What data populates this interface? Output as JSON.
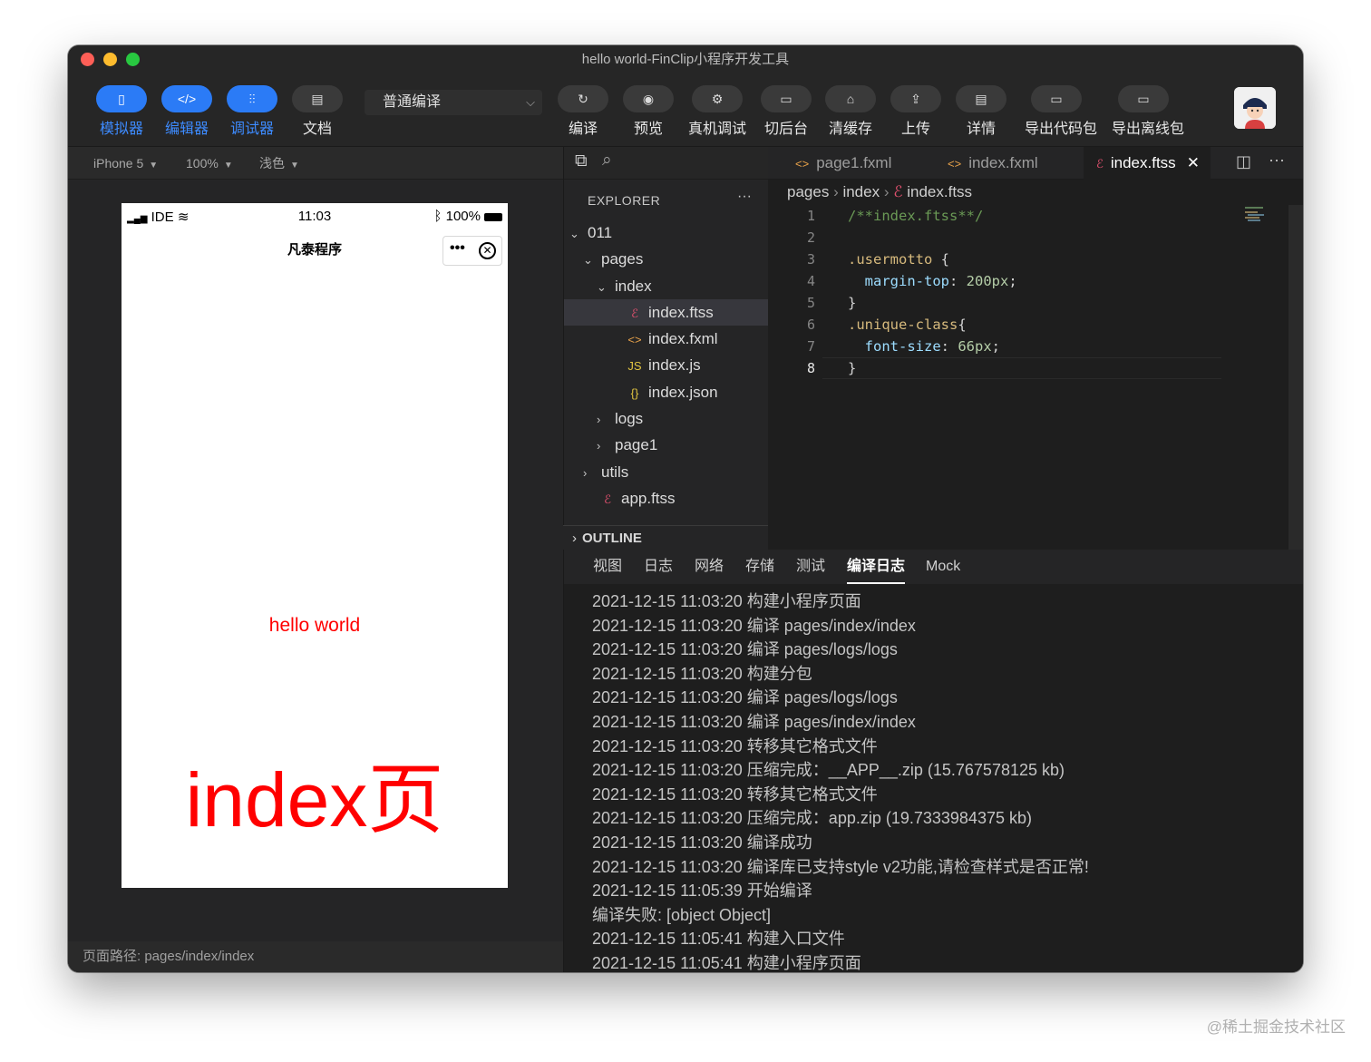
{
  "window": {
    "title": "hello world-FinClip小程序开发工具"
  },
  "toolbar": {
    "simulator": "模拟器",
    "editor": "编辑器",
    "debugger": "调试器",
    "docs": "文档",
    "compile_mode": "普通编译",
    "compile": "编译",
    "preview": "预览",
    "device_debug": "真机调试",
    "background": "切后台",
    "clear_cache": "清缓存",
    "upload": "上传",
    "details": "详情",
    "export_code": "导出代码包",
    "export_offline": "导出离线包"
  },
  "sim_bar": {
    "device": "iPhone 5",
    "zoom": "100%",
    "theme": "浅色"
  },
  "phone": {
    "carrier": "IDE",
    "time": "11:03",
    "battery": "100%",
    "nav_title": "凡泰程序",
    "hello": "hello world",
    "index_text": "index页"
  },
  "sim_footer": {
    "path": "页面路径: pages/index/index"
  },
  "explorer": {
    "title": "EXPLORER",
    "more": "···",
    "tree": [
      {
        "label": "011",
        "depth": 0,
        "chevron": "down",
        "icon": ""
      },
      {
        "label": "pages",
        "depth": 1,
        "chevron": "down",
        "icon": ""
      },
      {
        "label": "index",
        "depth": 2,
        "chevron": "down",
        "icon": ""
      },
      {
        "label": "index.ftss",
        "depth": 3,
        "chevron": "",
        "icon": "style-icon",
        "selected": true
      },
      {
        "label": "index.fxml",
        "depth": 3,
        "chevron": "",
        "icon": "markup-icon"
      },
      {
        "label": "index.js",
        "depth": 3,
        "chevron": "",
        "icon": "js-icon"
      },
      {
        "label": "index.json",
        "depth": 3,
        "chevron": "",
        "icon": "json-icon"
      },
      {
        "label": "logs",
        "depth": 2,
        "chevron": "right",
        "icon": ""
      },
      {
        "label": "page1",
        "depth": 2,
        "chevron": "right",
        "icon": ""
      },
      {
        "label": "utils",
        "depth": 1,
        "chevron": "right",
        "icon": ""
      },
      {
        "label": "app.ftss",
        "depth": 1,
        "chevron": "",
        "icon": "style-icon"
      }
    ],
    "outline": "OUTLINE"
  },
  "editor": {
    "tabs": [
      {
        "label": "page1.fxml",
        "icon": "markup-icon"
      },
      {
        "label": "index.fxml",
        "icon": "markup-icon"
      },
      {
        "label": "index.ftss",
        "icon": "style-icon",
        "active": true
      }
    ],
    "breadcrumb": [
      "pages",
      "index",
      "index.ftss"
    ],
    "lines": [
      "1",
      "2",
      "3",
      "4",
      "5",
      "6",
      "7",
      "8"
    ]
  },
  "bottom": {
    "tabs": [
      "视图",
      "日志",
      "网络",
      "存储",
      "测试",
      "编译日志",
      "Mock"
    ],
    "active_tab": "编译日志",
    "log": [
      "2021-12-15 11:03:20 构建小程序页面",
      "2021-12-15 11:03:20 编译 pages/index/index",
      "2021-12-15 11:03:20 编译 pages/logs/logs",
      "2021-12-15 11:03:20 构建分包",
      "2021-12-15 11:03:20 编译 pages/logs/logs",
      "2021-12-15 11:03:20 编译 pages/index/index",
      "2021-12-15 11:03:20 转移其它格式文件",
      "2021-12-15 11:03:20 压缩完成：__APP__.zip (15.767578125 kb)",
      "2021-12-15 11:03:20 转移其它格式文件",
      "2021-12-15 11:03:20 压缩完成：app.zip (19.7333984375 kb)",
      "2021-12-15 11:03:20 编译成功",
      "2021-12-15 11:03:20 编译库已支持style v2功能,请检查样式是否正常!",
      "2021-12-15 11:05:39 开始编译",
      "编译失败: [object Object]",
      "2021-12-15 11:05:41 构建入口文件",
      "2021-12-15 11:05:41 构建小程序页面"
    ]
  },
  "watermark": "@稀土掘金技术社区",
  "colors": {
    "accent": "#2b7bf6",
    "phone_text": "#ff0000",
    "style_icon": "#e0506e",
    "markup_icon": "#e8a24a",
    "js_icon": "#e2c541"
  }
}
